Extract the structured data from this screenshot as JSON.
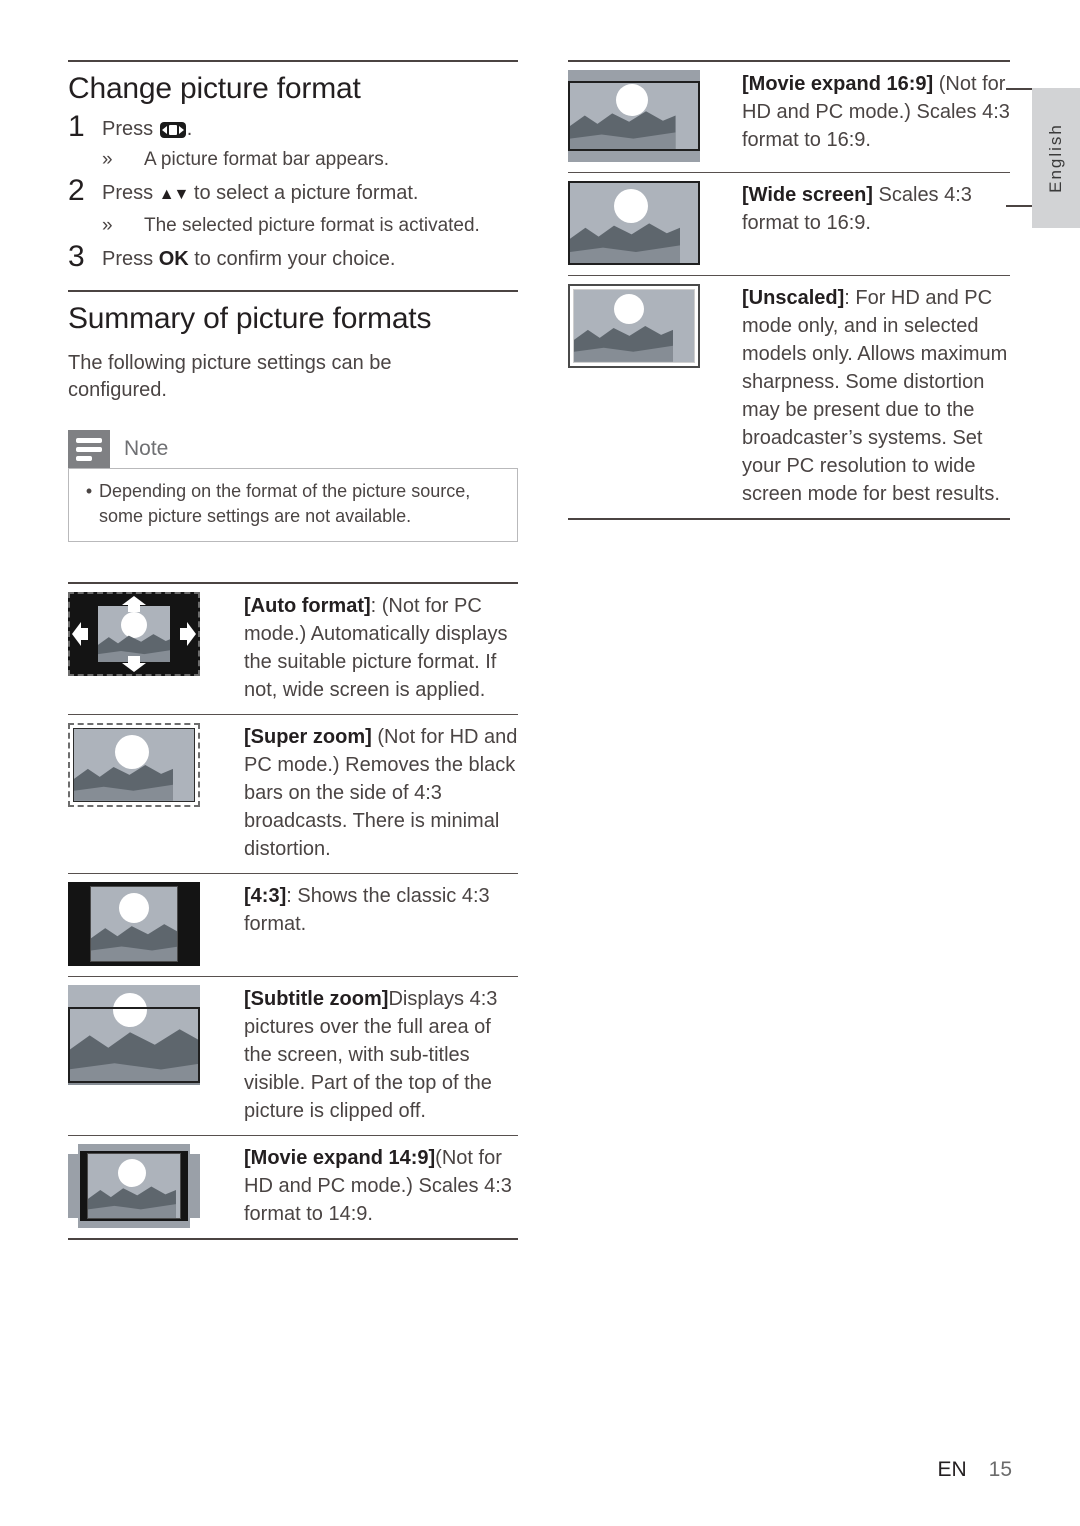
{
  "language_tab": {
    "label": "English"
  },
  "footer": {
    "locale": "EN",
    "page_number": "15"
  },
  "left_column": {
    "section1": {
      "title": "Change picture format",
      "steps": [
        {
          "number": "1",
          "text_before": "Press",
          "icon": "picture-format-key-icon",
          "text_after": ".",
          "substep": "A picture format bar appears.",
          "guillemet": "»"
        },
        {
          "number": "2",
          "text_before": "Press",
          "icon": "up-down-arrows-icon",
          "icon_glyph": "▲▼",
          "text_after": "to select a picture format.",
          "substep": "The selected picture format is activated.",
          "guillemet": "»"
        },
        {
          "number": "3",
          "text_before": "Press",
          "bold": "OK",
          "text_after": "to confirm your choice."
        }
      ]
    },
    "section2": {
      "title": "Summary of picture formats",
      "intro": "The following picture settings can be configured.",
      "note": {
        "label": "Note",
        "bullet": "•",
        "text": "Depending on the format of the picture source, some picture settings are not available."
      }
    },
    "formats": [
      {
        "name": "[Auto format]",
        "description": ": (Not for PC mode.) Automatically displays the suitable picture format. If not, wide screen is applied.",
        "thumb": "auto-format-thumbnail"
      },
      {
        "name": "[Super zoom]",
        "description": "(Not for HD and PC mode.) Removes the black bars on the side of 4:3 broadcasts. There is minimal distortion.",
        "thumb": "super-zoom-thumbnail"
      },
      {
        "name": "[4:3]",
        "description": ": Shows the classic 4:3 format.",
        "thumb": "four-three-thumbnail"
      },
      {
        "name": "[Subtitle zoom]",
        "description": "Displays 4:3 pictures over the full area of the screen, with sub-titles visible. Part of the top of the picture is clipped off.",
        "thumb": "subtitle-zoom-thumbnail"
      },
      {
        "name": "[Movie expand 14:9]",
        "description": "(Not for HD and PC mode.) Scales 4:3 format to 14:9.",
        "thumb": "movie-expand-14-9-thumbnail"
      }
    ]
  },
  "right_column": {
    "formats": [
      {
        "name": "[Movie expand 16:9]",
        "description": "(Not for HD and PC mode.) Scales 4:3 format to 16:9.",
        "thumb": "movie-expand-16-9-thumbnail"
      },
      {
        "name": "[Wide screen]",
        "description": "Scales 4:3 format to 16:9.",
        "thumb": "wide-screen-thumbnail"
      },
      {
        "name": "[Unscaled]",
        "description": ": For HD and PC mode only, and in selected models only. Allows maximum sharpness. Some distortion may be present due to the broadcaster’s systems. Set your PC resolution to wide screen mode for best results.",
        "thumb": "unscaled-thumbnail"
      }
    ]
  },
  "colors": {
    "sky": "#adb3bb",
    "hill_dark": "#5e666d",
    "hill_mid": "#868d95",
    "letterbox_black": "#141414",
    "letterbox_gray": "#9aa0a8",
    "note_header": "#7f8083",
    "lang_tab": "#d2d3d5"
  }
}
